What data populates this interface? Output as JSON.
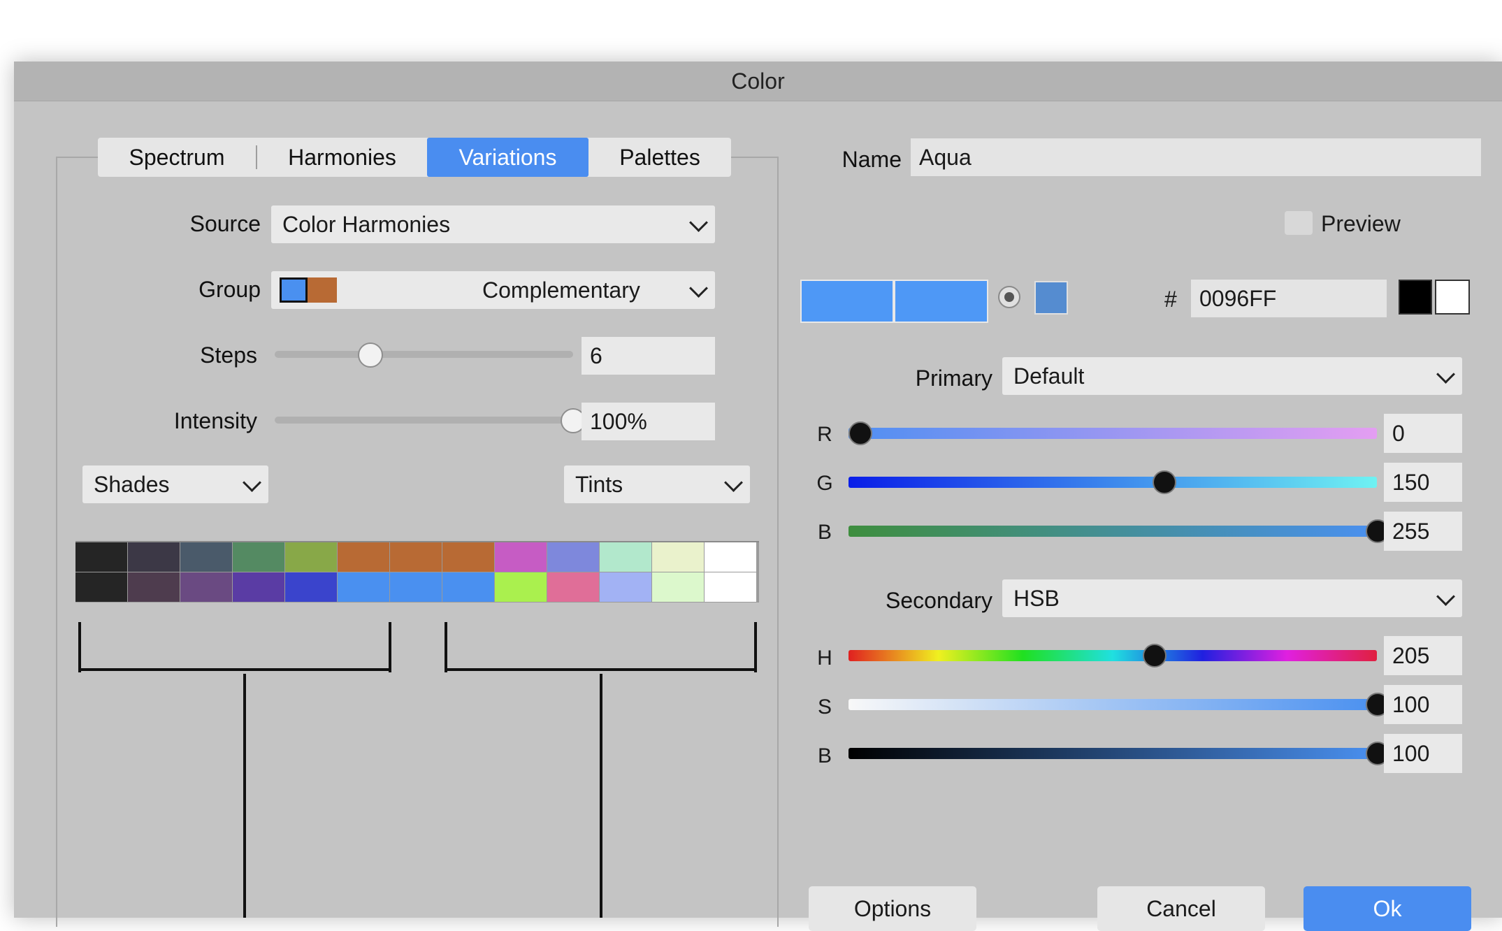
{
  "window": {
    "title": "Color"
  },
  "tabs": [
    {
      "label": "Spectrum"
    },
    {
      "label": "Harmonies"
    },
    {
      "label": "Variations",
      "selected": true
    },
    {
      "label": "Palettes"
    }
  ],
  "left": {
    "source_label": "Source",
    "source_value": "Color Harmonies",
    "group_label": "Group",
    "group_value": "Complementary",
    "group_colors": [
      "#4a90f0",
      "#b86a34"
    ],
    "steps_label": "Steps",
    "steps_value": "6",
    "steps_fraction": 0.29,
    "intensity_label": "Intensity",
    "intensity_value": "100%",
    "intensity_fraction": 1.0,
    "shades_label": "Shades",
    "tints_label": "Tints",
    "swatch_rows": [
      [
        "#252525",
        "#3c3846",
        "#4a5a6a",
        "#548a62",
        "#88a848",
        "#b86a34",
        "#b86a34",
        "#b86a34",
        "#c65cc4",
        "#7e88dc",
        "#b2e8cc",
        "#eaf2cc",
        "#ffffff"
      ],
      [
        "#252525",
        "#4e3c4e",
        "#6a4a82",
        "#5a3ca4",
        "#3a44cc",
        "#4a90f0",
        "#4a90f0",
        "#4a90f0",
        "#aaf04e",
        "#e06e98",
        "#a2b2f4",
        "#dcf8cc",
        "#ffffff"
      ]
    ]
  },
  "right": {
    "name_label": "Name",
    "name_value": "Aqua",
    "preview_label": "Preview",
    "preview_checked": false,
    "current_color": "#4e98f6",
    "new_color": "#4e98f6",
    "web_color": "#558cd0",
    "hash_label": "#",
    "hex_value": "0096FF",
    "primary_label": "Primary",
    "primary_value": "Default",
    "rgb": [
      {
        "label": "R",
        "value": "0",
        "fraction": 0.0
      },
      {
        "label": "G",
        "value": "150",
        "fraction": 0.588
      },
      {
        "label": "B",
        "value": "255",
        "fraction": 1.0
      }
    ],
    "secondary_label": "Secondary",
    "secondary_value": "HSB",
    "hsb": [
      {
        "label": "H",
        "value": "205",
        "fraction": 0.569
      },
      {
        "label": "S",
        "value": "100",
        "fraction": 1.0
      },
      {
        "label": "B",
        "value": "100",
        "fraction": 1.0
      }
    ]
  },
  "buttons": {
    "options": "Options",
    "cancel": "Cancel",
    "ok": "Ok"
  }
}
